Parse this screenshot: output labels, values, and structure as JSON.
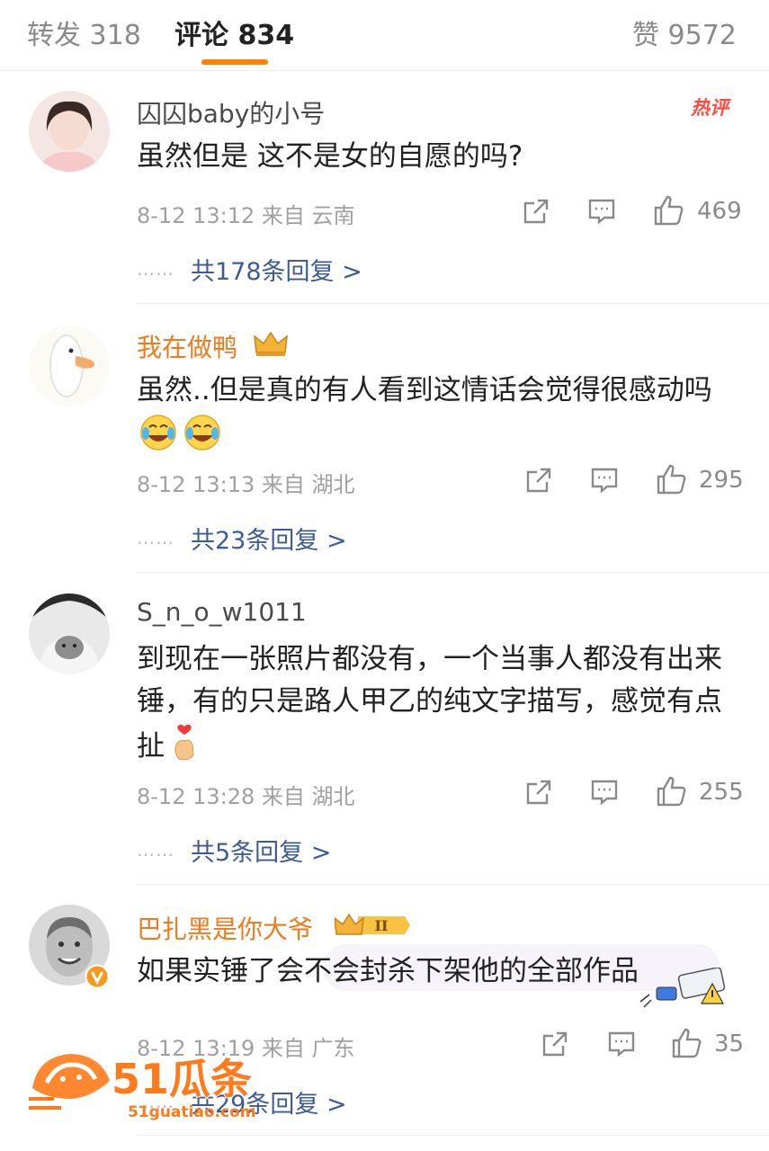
{
  "tabs": {
    "repost": "转发 318",
    "comments": "评论 834",
    "likes": "赞 9572"
  },
  "comments": [
    {
      "username": "囚囚baby的小号",
      "badge": "热评",
      "text": "虽然但是 这不是女的自愿的吗?",
      "meta": "8-12 13:12  来自 云南",
      "likes": "469",
      "replies": "共178条回复 >"
    },
    {
      "username": "我在做鸭",
      "text": "虽然..但是真的有人看到这情话会觉得很感动吗",
      "emojis": [
        "laugh-cry-emoji",
        "laugh-cry-emoji"
      ],
      "meta": "8-12 13:13  来自 湖北",
      "likes": "295",
      "replies": "共23条回复 >"
    },
    {
      "username": "S_n_o_w1011",
      "text": "到现在一张照片都没有，一个当事人都没有出来锤，有的只是路人甲乙的纯文字描写，感觉有点扯",
      "meta": "8-12 13:28  来自 湖北",
      "likes": "255",
      "replies": "共5条回复 >"
    },
    {
      "username": "巴扎黑是你大爷",
      "vip_level": "II",
      "text": "如果实锤了会不会封杀下架他的全部作品",
      "meta": "8-12 13:19  来自 广东",
      "likes": "35",
      "replies": "共29条回复 >"
    }
  ],
  "reply_dots": "⋯⋯",
  "watermark": {
    "brand": "51瓜条",
    "url": "51guatiao.com"
  },
  "colors": {
    "accent": "#ff8200",
    "link": "#3d5b96",
    "hot": "#ff4b3e",
    "vip_name": "#f07a1b"
  }
}
